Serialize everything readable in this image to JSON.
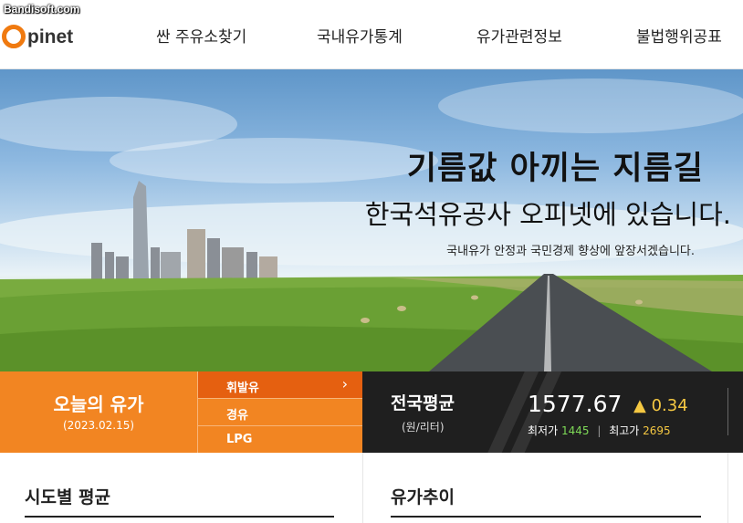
{
  "watermark": "Bandisoft.com",
  "brand": {
    "logo_text": "pinet",
    "accent": "#f28522"
  },
  "nav": {
    "items": [
      "싼 주유소찾기",
      "국내유가통계",
      "유가관련정보",
      "불법행위공표"
    ]
  },
  "hero": {
    "title": "기름값 아끼는 지름길",
    "subtitle": "한국석유공사 오피넷에 있습니다.",
    "tagline": "국내유가 안정과 국민경제 향상에 앞장서겠습니다."
  },
  "today": {
    "title": "오늘의 유가",
    "date": "(2023.02.15)"
  },
  "fuel_tabs": {
    "items": [
      "휘발유",
      "경유",
      "LPG"
    ],
    "active": "휘발유",
    "chevron": "›"
  },
  "national": {
    "title": "전국평균",
    "unit": "(원/리터)",
    "price": "1577.67",
    "change_icon": "▲",
    "change": "0.34",
    "min_label": "최저가",
    "min_value": "1445",
    "separator": "|",
    "max_label": "최고가",
    "max_value": "2695"
  },
  "sections": {
    "left_title": "시도별 평균",
    "right_title": "유가추이"
  }
}
